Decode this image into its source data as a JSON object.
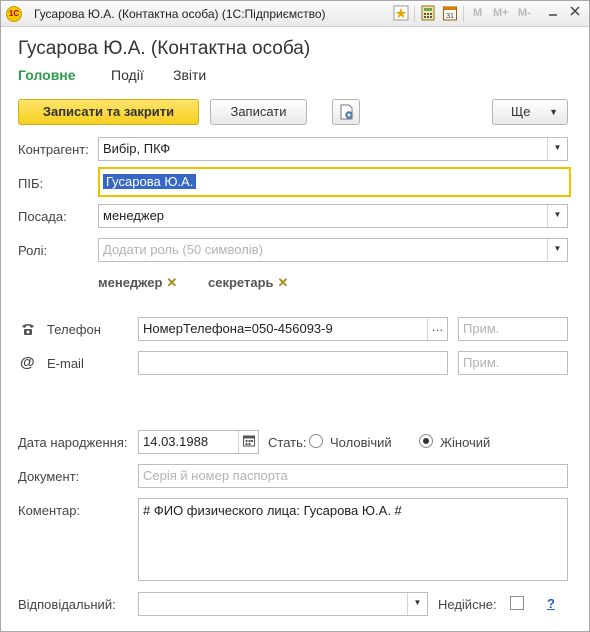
{
  "window": {
    "title": "Гусарова Ю.А. (Контактна особа)  (1С:Підприємство)",
    "logo": "1С",
    "memory_buttons": [
      "M",
      "M+",
      "M-"
    ],
    "controls": [
      "minimize-icon",
      "maximize-icon",
      "close-icon"
    ]
  },
  "form": {
    "title": "Гусарова Ю.А. (Контактна особа)",
    "tabs": [
      {
        "label": "Головне",
        "active": true
      },
      {
        "label": "Події",
        "active": false
      },
      {
        "label": "Звіти",
        "active": false
      }
    ]
  },
  "toolbar": {
    "save_close_label": "Записати та закрити",
    "save_label": "Записати",
    "more_label": "Ще"
  },
  "fields": {
    "counterparty_label": "Контрагент:",
    "counterparty_value": "Вибір, ПКФ",
    "name_label": "ПІБ:",
    "name_value": "Гусарова Ю.А.",
    "position_label": "Посада:",
    "position_value": "менеджер",
    "roles_label": "Ролі:",
    "roles_placeholder": "Додати роль (50 символів)",
    "roles_tags": [
      "менеджер",
      "секретарь"
    ],
    "phone_label": "Телефон",
    "phone_value": "НомерТелефона=050-456093-9",
    "phone_note_placeholder": "Прим.",
    "email_label": "E-mail",
    "email_value": "",
    "email_note_placeholder": "Прим.",
    "birth_label": "Дата народження:",
    "birth_value": "14.03.1988",
    "gender_label": "Стать:",
    "gender_options": [
      {
        "label": "Чоловічий",
        "selected": false
      },
      {
        "label": "Жіночий",
        "selected": true
      }
    ],
    "document_label": "Документ:",
    "document_placeholder": "Серія й номер паспорта",
    "comment_label": "Коментар:",
    "comment_value": "# ФИО физического лица: Гусарова Ю.А. #",
    "responsible_label": "Відповідальний:",
    "responsible_value": "",
    "inactive_label": "Недійсне:",
    "inactive_checked": false,
    "help_label": "?"
  },
  "colors": {
    "accent_green": "#2d9b4f",
    "primary_button": "#f5cf1f",
    "selection": "#3768c6",
    "focus_border": "#f0c300"
  }
}
